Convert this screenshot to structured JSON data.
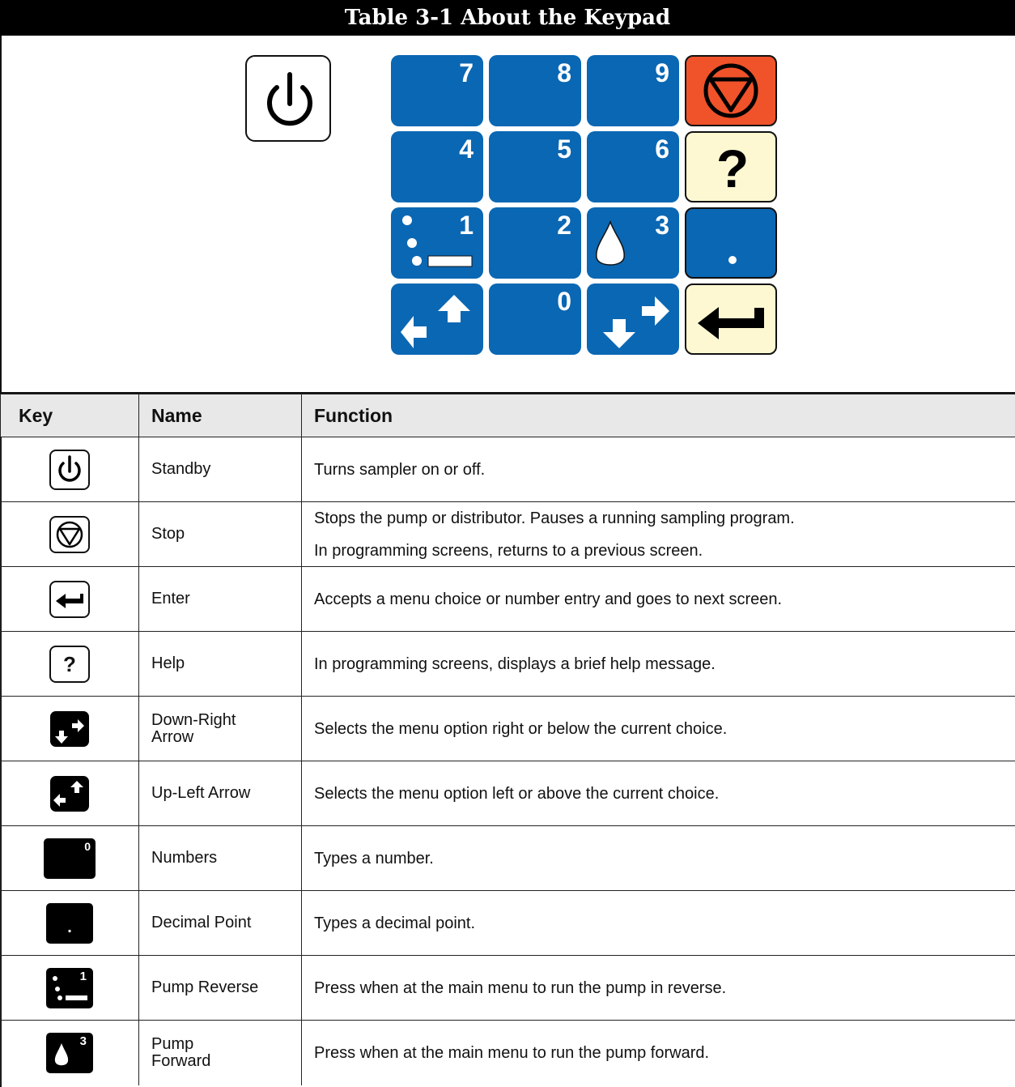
{
  "title": "Table 3-1  About the Keypad",
  "keypad": {
    "keys": [
      {
        "label": "7",
        "color": "#0a67b3"
      },
      {
        "label": "8",
        "color": "#0a67b3"
      },
      {
        "label": "9",
        "color": "#0a67b3"
      },
      {
        "label": "4",
        "color": "#0a67b3"
      },
      {
        "label": "5",
        "color": "#0a67b3"
      },
      {
        "label": "6",
        "color": "#0a67b3"
      },
      {
        "label": "1",
        "color": "#0a67b3"
      },
      {
        "label": "2",
        "color": "#0a67b3"
      },
      {
        "label": "3",
        "color": "#0a67b3"
      },
      {
        "label": "0",
        "color": "#0a67b3"
      },
      {
        "label": "?",
        "color": "#fdf8d2"
      }
    ],
    "stop_color": "#f0522a",
    "help_color": "#fdf8d2",
    "numpad_color": "#0a67b3"
  },
  "table": {
    "headers": {
      "key": "Key",
      "name": "Name",
      "function": "Function"
    },
    "rows": [
      {
        "icon": "standby-icon",
        "name": "Standby",
        "function": [
          "Turns sampler on or off."
        ]
      },
      {
        "icon": "stop-icon",
        "name": "Stop",
        "function": [
          "Stops the pump or distributor. Pauses a running sampling program.",
          "In programming screens, returns to a previous screen."
        ]
      },
      {
        "icon": "enter-icon",
        "name": "Enter",
        "function": [
          "Accepts a menu choice or number entry and goes to next screen."
        ]
      },
      {
        "icon": "help-icon",
        "icon_text": "?",
        "name": "Help",
        "function": [
          "In programming screens, displays a brief help message."
        ]
      },
      {
        "icon": "down-right-arrow-icon",
        "name": "Down-Right Arrow",
        "function": [
          "Selects the menu option right or below the current choice."
        ]
      },
      {
        "icon": "up-left-arrow-icon",
        "name": "Up-Left Arrow",
        "function": [
          "Selects the menu option left or above the current choice."
        ]
      },
      {
        "icon": "number-key-icon",
        "icon_text": "0",
        "name": "Numbers",
        "function": [
          "Types a number."
        ]
      },
      {
        "icon": "decimal-point-icon",
        "icon_text": ".",
        "name": "Decimal Point",
        "function": [
          "Types a decimal point."
        ]
      },
      {
        "icon": "pump-reverse-icon",
        "icon_text": "1",
        "name": "Pump Reverse",
        "function": [
          "Press when at the main menu to run the pump in reverse."
        ]
      },
      {
        "icon": "pump-forward-icon",
        "icon_text": "3",
        "name": "Pump Forward",
        "function": [
          "Press when at the main menu to run the pump forward."
        ]
      }
    ]
  }
}
